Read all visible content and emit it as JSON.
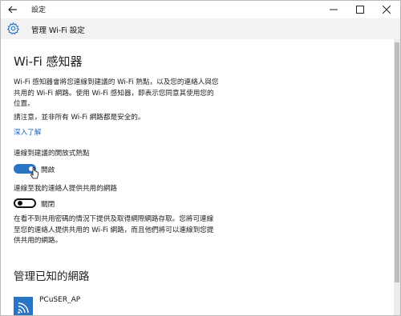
{
  "window": {
    "title": "設定",
    "back_icon": "arrow-left-icon",
    "controls": [
      "minimize-icon",
      "maximize-icon",
      "close-icon"
    ]
  },
  "header": {
    "icon": "gear-icon",
    "title": "管理 Wi-Fi 設定"
  },
  "content": {
    "heading": "Wi-Fi 感知器",
    "description_lines": [
      "Wi-Fi 感知器會將您連線到建議的 Wi-Fi 熱點，以及您的連絡人與您",
      "共用的 Wi-Fi 網路。使用 Wi-Fi 感知器，即表示您同意其使用您的",
      "位置。"
    ],
    "notice": "請注意，並非所有 Wi-Fi 網路都是安全的。",
    "learn_more": "深入了解",
    "setting1": {
      "label": "連線到建議的開放式熱點",
      "state": "開啟",
      "on": true
    },
    "setting2": {
      "label": "連線至我的連絡人提供共用的網路",
      "state": "關閉",
      "on": false
    },
    "info_lines": [
      "在看不到共用密碼的情況下提供及取得網際網路存取。您將可連線",
      "至您的連絡人提供共用的 Wi-Fi 網路，而且他們將可以連線到您提",
      "供共用的網路。"
    ],
    "known_networks_heading": "管理已知的網路",
    "networks": [
      {
        "name": "PCuSER_AP",
        "icon": "wifi-icon"
      }
    ]
  },
  "colors": {
    "accent": "#2a74c5",
    "link": "#1a65c0",
    "header_bg": "#f2f2f2"
  }
}
